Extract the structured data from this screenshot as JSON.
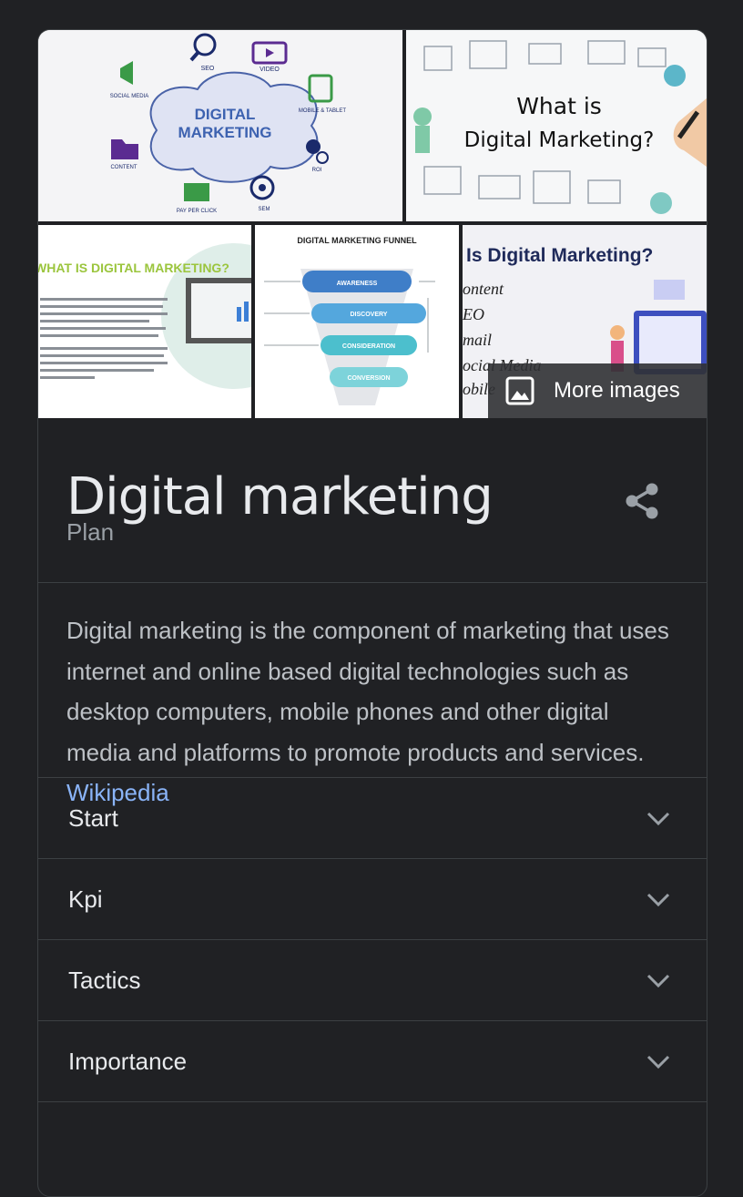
{
  "gallery": {
    "more_images_label": "More images",
    "thumbnails": [
      {
        "text_lines": [
          "DIGITAL",
          "MARKETING"
        ],
        "labels": [
          "SEO",
          "VIDEO",
          "SOCIAL MEDIA",
          "MOBILE & TABLET",
          "CONTENT",
          "ROI",
          "PAY PER CLICK",
          "SEM"
        ]
      },
      {
        "text_lines": [
          "What is",
          "Digital Marketing?"
        ]
      },
      {
        "heading": "WHAT IS DIGITAL MARKETING?"
      },
      {
        "heading": "DIGITAL MARKETING FUNNEL",
        "stages": [
          "AWARENESS",
          "DISCOVERY",
          "CONSIDERATION",
          "CONVERSION"
        ]
      },
      {
        "heading": "Is Digital Marketing?",
        "items": [
          "ontent",
          "EO",
          "mail",
          "ocial Media",
          "obile"
        ]
      }
    ]
  },
  "entity": {
    "title": "Digital marketing",
    "subtitle": "Plan"
  },
  "description": {
    "text": "Digital marketing is the component of marketing that uses internet and online based digital technologies such as desktop computers, mobile phones and other digital media and platforms to promote products and services. ",
    "source_link": "Wikipedia"
  },
  "sections": [
    {
      "label": "Start"
    },
    {
      "label": "Kpi"
    },
    {
      "label": "Tactics"
    },
    {
      "label": "Importance"
    }
  ],
  "colors": {
    "background": "#202124",
    "link": "#8ab4f8",
    "muted": "#9aa0a6"
  }
}
